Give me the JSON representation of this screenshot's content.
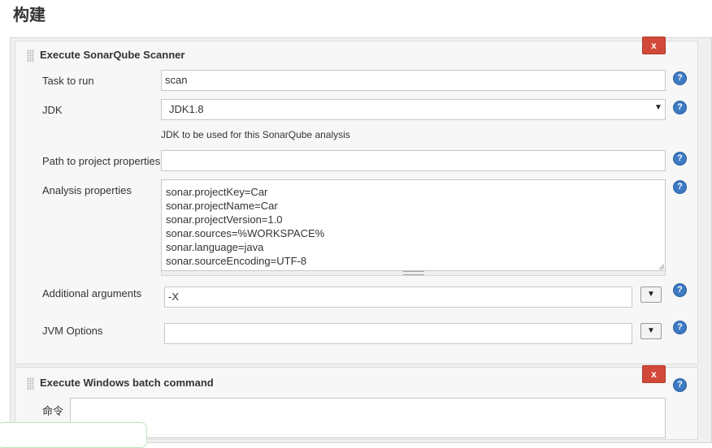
{
  "page": {
    "title": "构建"
  },
  "sonar_step": {
    "title": "Execute SonarQube Scanner",
    "close_label": "x",
    "task_label": "Task to run",
    "task_value": "scan",
    "jdk_label": "JDK",
    "jdk_value": "JDK1.8",
    "jdk_hint": "JDK to be used for this SonarQube analysis",
    "path_label": "Path to project properties",
    "path_value": "",
    "analysis_label": "Analysis properties",
    "analysis_lines": [
      "sonar.projectKey=Car",
      "sonar.projectName=Car",
      "sonar.projectVersion=1.0",
      "sonar.sources=%WORKSPACE%",
      "sonar.language=java",
      "sonar.sourceEncoding=UTF-8"
    ],
    "args_label": "Additional arguments",
    "args_value": "-X",
    "jvm_label": "JVM Options",
    "jvm_value": ""
  },
  "batch_step": {
    "title": "Execute Windows batch command",
    "close_label": "x",
    "command_label": "命令",
    "command_value": ""
  },
  "icons": {
    "help": "?",
    "dropdown_arrow": "▼"
  },
  "colors": {
    "close_button": "#d24939",
    "help_icon": "#3d7ac4"
  }
}
